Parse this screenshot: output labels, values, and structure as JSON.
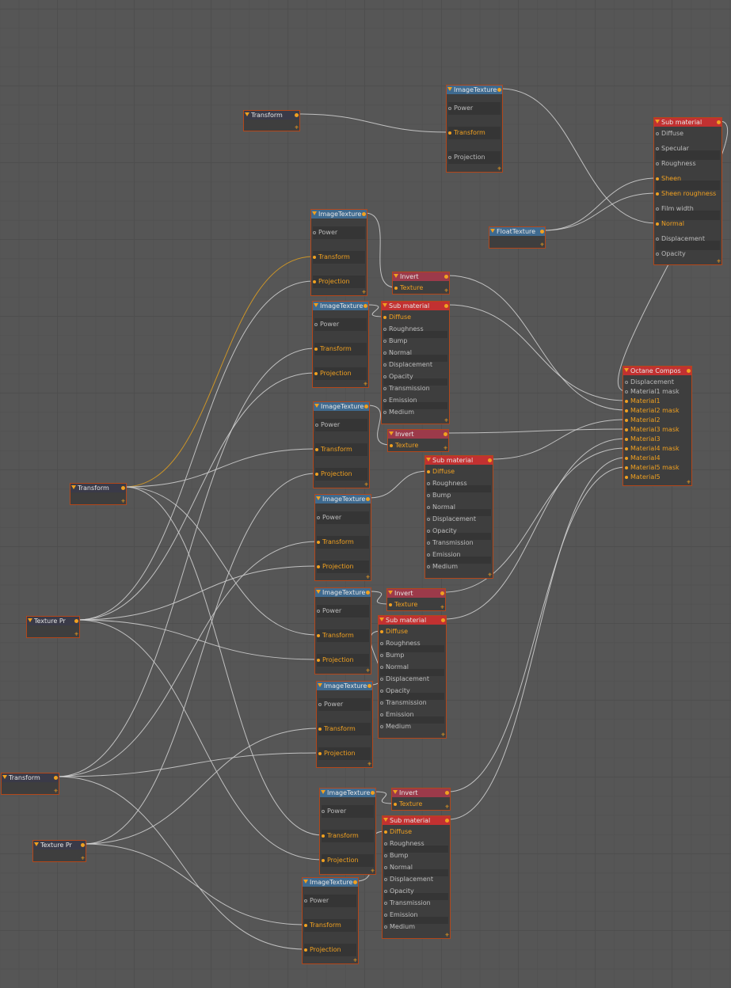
{
  "theme": {
    "accent": "#f0a020",
    "border": "#b3471a",
    "wire": "#d4d4d4",
    "wire_active": "#e0a020",
    "header_blue": "#3f6a8f",
    "header_red": "#c23131",
    "header_pink": "#9c3a4a",
    "header_dark": "#3a3a48"
  },
  "icons": {
    "collapse": "triangle-down-icon",
    "resize": "resize-grip-icon"
  },
  "labels": {
    "transform": "Transform",
    "image_texture": "ImageTexture",
    "invert": "Invert",
    "sub_material": "Sub material",
    "float_texture": "FloatTexture",
    "texture_projection": "Texture Pr",
    "octane_composite": "Octane Compos"
  },
  "nodes": [
    {
      "id": "tr_top",
      "title": "Transform",
      "kind": "dark",
      "inputs": []
    },
    {
      "id": "img_top",
      "title": "ImageTexture",
      "kind": "blue",
      "inputs": [
        {
          "label": "Power",
          "on": false
        },
        {
          "label": "Transform",
          "on": true
        },
        {
          "label": "Projection",
          "on": false
        }
      ]
    },
    {
      "id": "sub_top",
      "title": "Sub material",
      "kind": "red",
      "inputs": [
        {
          "label": "Diffuse",
          "on": false
        },
        {
          "label": "Specular",
          "on": false
        },
        {
          "label": "Roughness",
          "on": false
        },
        {
          "label": "Sheen",
          "on": true
        },
        {
          "label": "Sheen roughness",
          "on": true
        },
        {
          "label": "Film width",
          "on": false
        },
        {
          "label": "Normal",
          "on": true
        },
        {
          "label": "Displacement",
          "on": false
        },
        {
          "label": "Opacity",
          "on": false
        }
      ]
    },
    {
      "id": "float",
      "title": "FloatTexture",
      "kind": "blue",
      "inputs": []
    },
    {
      "id": "img1",
      "title": "ImageTexture",
      "kind": "blue",
      "inputs": [
        {
          "label": "Power",
          "on": false
        },
        {
          "label": "Transform",
          "on": true
        },
        {
          "label": "Projection",
          "on": true
        }
      ]
    },
    {
      "id": "inv1",
      "title": "Invert",
      "kind": "pink",
      "inputs": [
        {
          "label": "Texture",
          "on": true
        }
      ]
    },
    {
      "id": "img2",
      "title": "ImageTexture",
      "kind": "blue",
      "inputs": [
        {
          "label": "Power",
          "on": false
        },
        {
          "label": "Transform",
          "on": true
        },
        {
          "label": "Projection",
          "on": true
        }
      ]
    },
    {
      "id": "sub1",
      "title": "Sub material",
      "kind": "red",
      "inputs": [
        {
          "label": "Diffuse",
          "on": true
        },
        {
          "label": "Roughness",
          "on": false
        },
        {
          "label": "Bump",
          "on": false
        },
        {
          "label": "Normal",
          "on": false
        },
        {
          "label": "Displacement",
          "on": false
        },
        {
          "label": "Opacity",
          "on": false
        },
        {
          "label": "Transmission",
          "on": false
        },
        {
          "label": "Emission",
          "on": false
        },
        {
          "label": "Medium",
          "on": false
        }
      ]
    },
    {
      "id": "octane",
      "title": "Octane Compos",
      "kind": "red",
      "inputs": [
        {
          "label": "Displacement",
          "on": false
        },
        {
          "label": "Material1 mask",
          "on": false
        },
        {
          "label": "Material1",
          "on": true
        },
        {
          "label": "Material2 mask",
          "on": true
        },
        {
          "label": "Material2",
          "on": true
        },
        {
          "label": "Material3 mask",
          "on": true
        },
        {
          "label": "Material3",
          "on": true
        },
        {
          "label": "Material4 mask",
          "on": true
        },
        {
          "label": "Material4",
          "on": true
        },
        {
          "label": "Material5 mask",
          "on": true
        },
        {
          "label": "Material5",
          "on": true
        }
      ]
    },
    {
      "id": "img3",
      "title": "ImageTexture",
      "kind": "blue",
      "inputs": [
        {
          "label": "Power",
          "on": false
        },
        {
          "label": "Transform",
          "on": true
        },
        {
          "label": "Projection",
          "on": true
        }
      ]
    },
    {
      "id": "inv2",
      "title": "Invert",
      "kind": "pink",
      "inputs": [
        {
          "label": "Texture",
          "on": true
        }
      ]
    },
    {
      "id": "tr_mid",
      "title": "Transform",
      "kind": "dark",
      "inputs": []
    },
    {
      "id": "sub2",
      "title": "Sub material",
      "kind": "red",
      "inputs": [
        {
          "label": "Diffuse",
          "on": true
        },
        {
          "label": "Roughness",
          "on": false
        },
        {
          "label": "Bump",
          "on": false
        },
        {
          "label": "Normal",
          "on": false
        },
        {
          "label": "Displacement",
          "on": false
        },
        {
          "label": "Opacity",
          "on": false
        },
        {
          "label": "Transmission",
          "on": false
        },
        {
          "label": "Emission",
          "on": false
        },
        {
          "label": "Medium",
          "on": false
        }
      ]
    },
    {
      "id": "img4",
      "title": "ImageTexture",
      "kind": "blue",
      "inputs": [
        {
          "label": "Power",
          "on": false
        },
        {
          "label": "Transform",
          "on": true
        },
        {
          "label": "Projection",
          "on": true
        }
      ]
    },
    {
      "id": "img5",
      "title": "ImageTexture",
      "kind": "blue",
      "inputs": [
        {
          "label": "Power",
          "on": false
        },
        {
          "label": "Transform",
          "on": true
        },
        {
          "label": "Projection",
          "on": true
        }
      ]
    },
    {
      "id": "inv3",
      "title": "Invert",
      "kind": "pink",
      "inputs": [
        {
          "label": "Texture",
          "on": true
        }
      ]
    },
    {
      "id": "texpr1",
      "title": "Texture Pr",
      "kind": "dark",
      "inputs": []
    },
    {
      "id": "sub3",
      "title": "Sub material",
      "kind": "red",
      "inputs": [
        {
          "label": "Diffuse",
          "on": true
        },
        {
          "label": "Roughness",
          "on": false
        },
        {
          "label": "Bump",
          "on": false
        },
        {
          "label": "Normal",
          "on": false
        },
        {
          "label": "Displacement",
          "on": false
        },
        {
          "label": "Opacity",
          "on": false
        },
        {
          "label": "Transmission",
          "on": false
        },
        {
          "label": "Emission",
          "on": false
        },
        {
          "label": "Medium",
          "on": false
        }
      ]
    },
    {
      "id": "img6",
      "title": "ImageTexture",
      "kind": "blue",
      "inputs": [
        {
          "label": "Power",
          "on": false
        },
        {
          "label": "Transform",
          "on": true
        },
        {
          "label": "Projection",
          "on": true
        }
      ]
    },
    {
      "id": "tr_low",
      "title": "Transform",
      "kind": "dark",
      "inputs": []
    },
    {
      "id": "img7",
      "title": "ImageTexture",
      "kind": "blue",
      "inputs": [
        {
          "label": "Power",
          "on": false
        },
        {
          "label": "Transform",
          "on": true
        },
        {
          "label": "Projection",
          "on": true
        }
      ]
    },
    {
      "id": "inv4",
      "title": "Invert",
      "kind": "pink",
      "inputs": [
        {
          "label": "Texture",
          "on": true
        }
      ]
    },
    {
      "id": "sub4",
      "title": "Sub material",
      "kind": "red",
      "inputs": [
        {
          "label": "Diffuse",
          "on": true
        },
        {
          "label": "Roughness",
          "on": false
        },
        {
          "label": "Bump",
          "on": false
        },
        {
          "label": "Normal",
          "on": false
        },
        {
          "label": "Displacement",
          "on": false
        },
        {
          "label": "Opacity",
          "on": false
        },
        {
          "label": "Transmission",
          "on": false
        },
        {
          "label": "Emission",
          "on": false
        },
        {
          "label": "Medium",
          "on": false
        }
      ]
    },
    {
      "id": "texpr2",
      "title": "Texture Pr",
      "kind": "dark",
      "inputs": []
    },
    {
      "id": "img8",
      "title": "ImageTexture",
      "kind": "blue",
      "inputs": [
        {
          "label": "Power",
          "on": false
        },
        {
          "label": "Transform",
          "on": true
        },
        {
          "label": "Projection",
          "on": true
        }
      ]
    }
  ],
  "connections": [
    [
      "tr_top",
      "img_top",
      1
    ],
    [
      "img_top",
      "sub_top",
      6
    ],
    [
      "float",
      "sub_top",
      3
    ],
    [
      "float",
      "sub_top",
      4
    ],
    [
      "tr_mid",
      "img1",
      1
    ],
    [
      "texpr1",
      "img1",
      2
    ],
    [
      "img1",
      "inv1",
      0
    ],
    [
      "inv1",
      "octane",
      3
    ],
    [
      "tr_low",
      "img2",
      1
    ],
    [
      "texpr1",
      "img2",
      2
    ],
    [
      "img2",
      "sub1",
      0
    ],
    [
      "sub1",
      "octane",
      2
    ],
    [
      "tr_mid",
      "img3",
      1
    ],
    [
      "texpr2",
      "img3",
      2
    ],
    [
      "img3",
      "inv2",
      0
    ],
    [
      "inv2",
      "octane",
      5
    ],
    [
      "tr_low",
      "img4",
      1
    ],
    [
      "texpr1",
      "img4",
      2
    ],
    [
      "img4",
      "sub2",
      0
    ],
    [
      "sub2",
      "octane",
      4
    ],
    [
      "tr_mid",
      "img5",
      1
    ],
    [
      "texpr1",
      "img5",
      2
    ],
    [
      "img5",
      "inv3",
      0
    ],
    [
      "inv3",
      "octane",
      7
    ],
    [
      "texpr2",
      "img6",
      1
    ],
    [
      "tr_low",
      "img6",
      2
    ],
    [
      "img6",
      "sub3",
      0
    ],
    [
      "sub3",
      "octane",
      6
    ],
    [
      "tr_mid",
      "img7",
      1
    ],
    [
      "texpr1",
      "img7",
      2
    ],
    [
      "img7",
      "inv4",
      0
    ],
    [
      "inv4",
      "octane",
      9
    ],
    [
      "texpr2",
      "img8",
      1
    ],
    [
      "tr_low",
      "img8",
      2
    ],
    [
      "img8",
      "sub4",
      0
    ],
    [
      "sub4",
      "octane",
      8
    ],
    [
      "sub_top",
      "octane",
      1
    ]
  ]
}
